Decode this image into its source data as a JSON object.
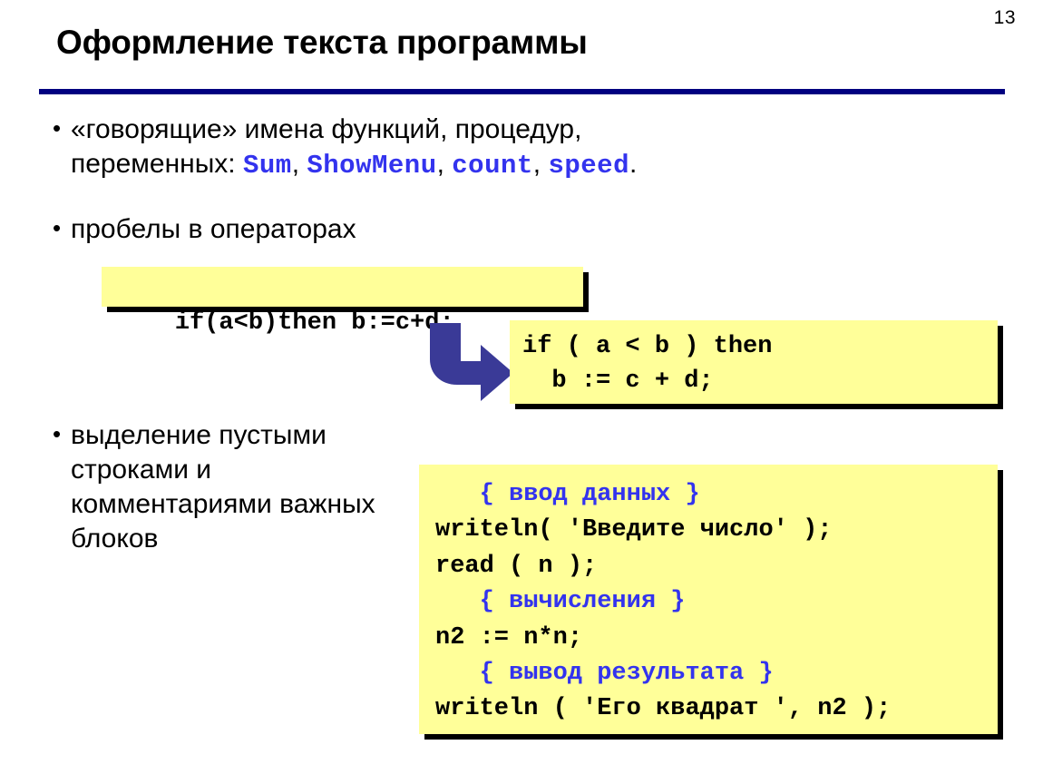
{
  "slide": {
    "page_number": "13",
    "title": "Оформление текста программы",
    "colors": {
      "rule": "#000080",
      "code_box_bg": "#ffff99",
      "code_blue": "#3333ee",
      "arrow": "#3a3a97",
      "text": "#000000"
    }
  },
  "bullets": [
    {
      "marker": "•",
      "line1_prefix": "«говорящие» имена функций, процедур,",
      "line2_prefix": "переменных: ",
      "code_names": [
        "Sum",
        "ShowMenu",
        "count",
        "speed"
      ],
      "separator": ", ",
      "terminator": "."
    },
    {
      "marker": "•",
      "text": "пробелы в операторах"
    },
    {
      "marker": "•",
      "text": "выделение пустыми строками и комментариями важных блоков"
    }
  ],
  "code_boxes": {
    "bad_spacing": {
      "lines": [
        "if(a<b)then b:=c+d;"
      ]
    },
    "good_spacing": {
      "lines": [
        "if ( a < b ) then",
        "  b := c + d;"
      ]
    },
    "comment_blocks": {
      "lines": [
        {
          "indent": "   ",
          "text": "{ ввод данных }",
          "style": "comment"
        },
        {
          "indent": "",
          "text": "writeln( 'Введите число' );",
          "style": "code"
        },
        {
          "indent": "",
          "text": "read ( n );",
          "style": "code"
        },
        {
          "indent": "   ",
          "text": "{ вычисления }",
          "style": "comment"
        },
        {
          "indent": "",
          "text": "n2 := n*n;",
          "style": "code"
        },
        {
          "indent": "   ",
          "text": "{ вывод результата }",
          "style": "comment"
        },
        {
          "indent": "",
          "text": "writeln ( 'Его квадрат ', n2 );",
          "style": "code"
        }
      ]
    }
  },
  "arrow": {
    "name": "elbow-arrow-down-right",
    "color": "#3a3a97"
  }
}
